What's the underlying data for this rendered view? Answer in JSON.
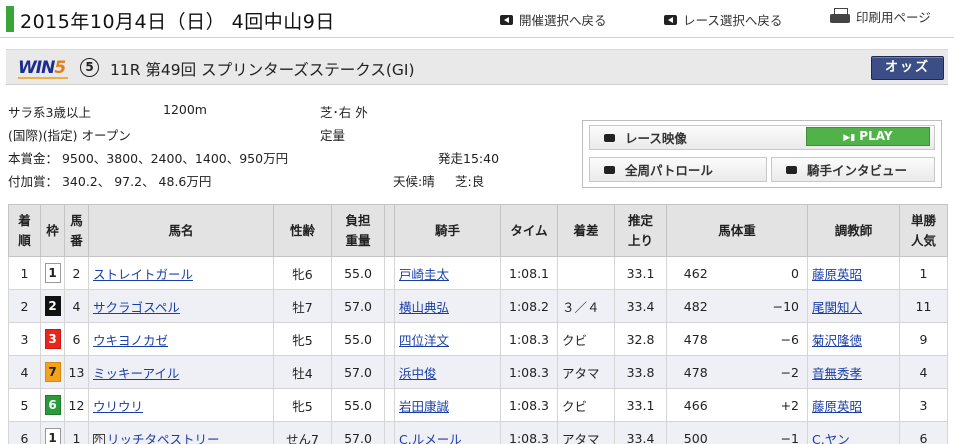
{
  "header": {
    "date": "2015年10月4日（日） 4回中山9日",
    "link_meeting": "開催選択へ戻る",
    "link_race": "レース選択へ戻る",
    "link_print": "印刷用ページ"
  },
  "race": {
    "win5_label": "WIN5",
    "win5_number": "⑤",
    "name": "11R 第49回 スプリンターズステークス(GI)",
    "odds_button": "オッズ"
  },
  "info": {
    "class": "サラ系3歳以上",
    "distance": "1200m",
    "course": "芝･右 外",
    "condition": "(国際)(指定) オープン",
    "weight_rule": "定量",
    "prize": "本賞金： 9500、3800、2400、1400、950万円",
    "post_time": "発走15:40",
    "added_prize": "付加賞： 340.2、 97.2、 48.6万円",
    "weather": "天候:晴",
    "going": "芝:良"
  },
  "media": {
    "video": "レース映像",
    "play": "PLAY",
    "patrol": "全周パトロール",
    "interview": "騎手インタビュー"
  },
  "table": {
    "headers": {
      "rank": [
        "着",
        "順"
      ],
      "waku": "枠",
      "umaban": [
        "馬",
        "番"
      ],
      "horse": "馬名",
      "sexage": "性齢",
      "weight": [
        "負担",
        "重量"
      ],
      "jockey": "騎手",
      "time": "タイム",
      "margin": "着差",
      "last3f": [
        "推定",
        "上り"
      ],
      "bodyweight": "馬体重",
      "trainer": "調教師",
      "pop": [
        "単勝",
        "人気"
      ]
    },
    "rows": [
      {
        "rank": "1",
        "waku": "1",
        "umaban": "2",
        "horse": "ストレイトガール",
        "sexage": "牝6",
        "weight": "55.0",
        "jockey": "戸崎圭太",
        "time": "1:08.1",
        "margin": "",
        "last3f": "33.1",
        "bw": "462",
        "bwdiff": "0",
        "trainer": "藤原英昭",
        "pop": "1"
      },
      {
        "rank": "2",
        "waku": "2",
        "umaban": "4",
        "horse": "サクラゴスペル",
        "sexage": "牡7",
        "weight": "57.0",
        "jockey": "横山典弘",
        "time": "1:08.2",
        "margin": "３／４",
        "last3f": "33.4",
        "bw": "482",
        "bwdiff": "−10",
        "trainer": "尾関知人",
        "pop": "11"
      },
      {
        "rank": "3",
        "waku": "3",
        "umaban": "6",
        "horse": "ウキヨノカゼ",
        "sexage": "牝5",
        "weight": "55.0",
        "jockey": "四位洋文",
        "time": "1:08.3",
        "margin": "クビ",
        "last3f": "32.8",
        "bw": "478",
        "bwdiff": "−6",
        "trainer": "菊沢隆徳",
        "pop": "9"
      },
      {
        "rank": "4",
        "waku": "7",
        "umaban": "13",
        "horse": "ミッキーアイル",
        "sexage": "牡4",
        "weight": "57.0",
        "jockey": "浜中俊",
        "time": "1:08.3",
        "margin": "アタマ",
        "last3f": "33.8",
        "bw": "478",
        "bwdiff": "−2",
        "trainer": "音無秀孝",
        "pop": "4"
      },
      {
        "rank": "5",
        "waku": "6",
        "umaban": "12",
        "horse": "ウリウリ",
        "sexage": "牝5",
        "weight": "55.0",
        "jockey": "岩田康誠",
        "time": "1:08.3",
        "margin": "クビ",
        "last3f": "33.1",
        "bw": "466",
        "bwdiff": "+2",
        "trainer": "藤原英昭",
        "pop": "3"
      },
      {
        "rank": "6",
        "waku": "1",
        "umaban": "1",
        "horse": "リッチタペストリー",
        "sexage": "せん7",
        "weight": "57.0",
        "jockey": "C.ルメール",
        "time": "1:08.3",
        "margin": "アタマ",
        "last3f": "33.4",
        "bw": "500",
        "bwdiff": "−1",
        "trainer": "C.ヤン",
        "pop": "6"
      }
    ]
  }
}
